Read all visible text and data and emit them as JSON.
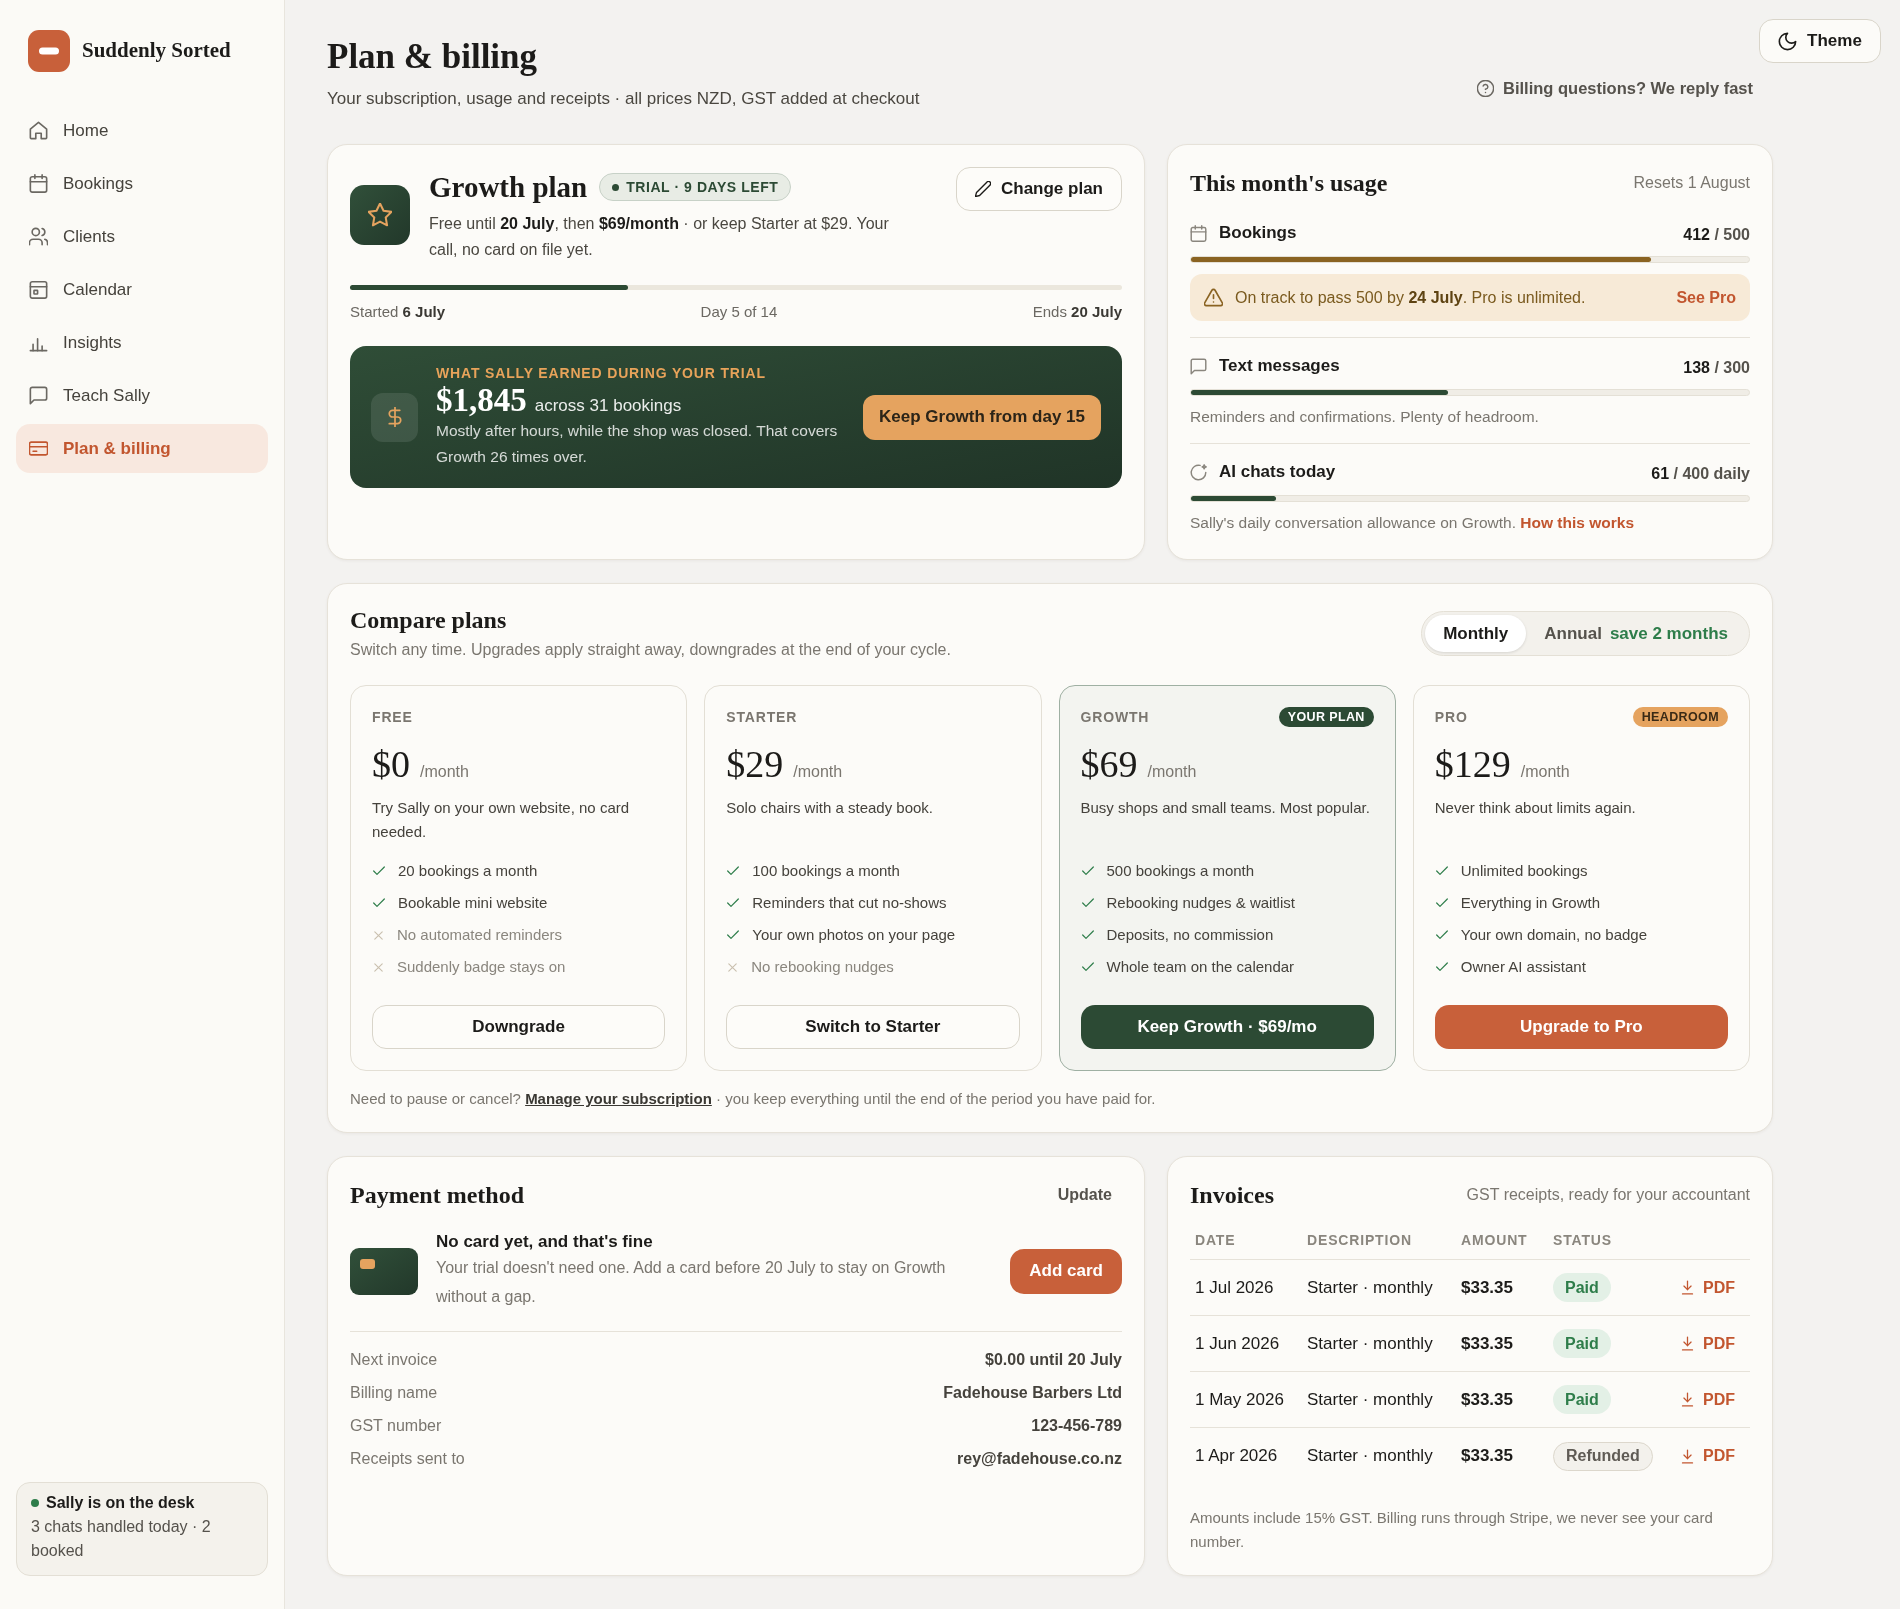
{
  "sidebar": {
    "brand": "Suddenly Sorted",
    "nav": [
      {
        "label": "Home",
        "selected": false
      },
      {
        "label": "Bookings",
        "selected": false
      },
      {
        "label": "Clients",
        "selected": false
      },
      {
        "label": "Calendar",
        "selected": false
      },
      {
        "label": "Insights",
        "selected": false
      },
      {
        "label": "Teach Sally",
        "selected": false
      },
      {
        "label": "Plan & billing",
        "selected": true
      }
    ],
    "status_card": {
      "title": "Sally is on the desk",
      "text": "3 chats handled today · 2 booked",
      "online": true
    }
  },
  "header": {
    "title": "Plan & billing",
    "subtitle": "Your subscription, usage and receipts · all prices NZD, GST added at checkout",
    "help_link": "Billing questions? We reply fast",
    "theme_button": "Theme"
  },
  "current_plan": {
    "name": "Growth plan",
    "badge": "TRIAL · 9 DAYS LEFT",
    "description": "Free until **20 July**, then **$69/month** · or keep Starter at $29. Your call, no card on file yet.",
    "change_button": "Change plan",
    "trial": {
      "level": 0.36,
      "start": "Started **6 July**",
      "progress": "Day 5 of 14",
      "end": "Ends **20 July**"
    },
    "earnings": {
      "eyebrow": "WHAT SALLY EARNED DURING YOUR TRIAL",
      "amount": "$1,845",
      "amount_note": "across 31 bookings",
      "text": "Mostly after hours, while the shop was closed. That covers Growth 26 times over.",
      "button": "Keep Growth from day 15"
    }
  },
  "usage": {
    "title": "This month's usage",
    "resets": "Resets 1 August",
    "meters": [
      {
        "label": "Bookings",
        "reading": "**412** / 500",
        "level": 0.824,
        "near_limit": true,
        "alert": {
          "text": "On track to pass 500 by **24 July**. Pro is unlimited.",
          "link": "See Pro"
        }
      },
      {
        "label": "Text messages",
        "reading": "**138** / 300",
        "level": 0.46,
        "near_limit": false,
        "note": "Reminders and confirmations. Plenty of headroom."
      },
      {
        "label": "AI chats today",
        "reading": "**61** / 400 daily",
        "level": 0.1525,
        "near_limit": false,
        "note": "Sally's daily conversation allowance on Growth.",
        "note_link": "How this works"
      }
    ]
  },
  "compare": {
    "title": "Compare plans",
    "subtitle": "Switch any time. Upgrades apply straight away, downgrades at the end of your cycle.",
    "billing_toggle": [
      {
        "label": "Monthly",
        "selected": true
      },
      {
        "label": "Annual",
        "note": "save 2 months",
        "selected": false
      }
    ],
    "plans": [
      {
        "name": "FREE",
        "price": "$0",
        "period": "/month",
        "description": "Try Sally on your own website, no card needed.",
        "features": [
          {
            "text": "20 bookings a month",
            "included": true
          },
          {
            "text": "Bookable mini website",
            "included": true
          },
          {
            "text": "No automated reminders",
            "included": false
          },
          {
            "text": "Suddenly badge stays on",
            "included": false
          }
        ],
        "button": {
          "label": "Downgrade",
          "kind": "outline"
        },
        "current": false
      },
      {
        "name": "STARTER",
        "price": "$29",
        "period": "/month",
        "description": "Solo chairs with a steady book.",
        "features": [
          {
            "text": "100 bookings a month",
            "included": true
          },
          {
            "text": "Reminders that cut no-shows",
            "included": true
          },
          {
            "text": "Your own photos on your page",
            "included": true
          },
          {
            "text": "No rebooking nudges",
            "included": false
          }
        ],
        "button": {
          "label": "Switch to Starter",
          "kind": "outline"
        },
        "current": false
      },
      {
        "name": "GROWTH",
        "badge": {
          "text": "YOUR PLAN",
          "kind": "dark"
        },
        "price": "$69",
        "period": "/month",
        "description": "Busy shops and small teams. Most popular.",
        "features": [
          {
            "text": "500 bookings a month",
            "included": true
          },
          {
            "text": "Rebooking nudges & waitlist",
            "included": true
          },
          {
            "text": "Deposits, no commission",
            "included": true
          },
          {
            "text": "Whole team on the calendar",
            "included": true
          }
        ],
        "button": {
          "label": "Keep Growth · $69/mo",
          "kind": "dark"
        },
        "current": true
      },
      {
        "name": "PRO",
        "badge": {
          "text": "HEADROOM",
          "kind": "accent"
        },
        "price": "$129",
        "period": "/month",
        "description": "Never think about limits again.",
        "features": [
          {
            "text": "Unlimited bookings",
            "included": true
          },
          {
            "text": "Everything in Growth",
            "included": true
          },
          {
            "text": "Your own domain, no badge",
            "included": true
          },
          {
            "text": "Owner AI assistant",
            "included": true
          }
        ],
        "button": {
          "label": "Upgrade to Pro",
          "kind": "accent"
        },
        "current": false
      }
    ],
    "footer": {
      "before": "Need to pause or cancel?",
      "link": "Manage your subscription",
      "after": "· you keep everything until the end of the period you have paid for."
    }
  },
  "payment": {
    "title": "Payment method",
    "update_link": "Update",
    "notice": {
      "title": "No card yet, and that's fine",
      "text": "Your trial doesn't need one. Add a card before 20 July to stay on Growth without a gap.",
      "button": "Add card"
    },
    "details": [
      {
        "label": "Next invoice",
        "value": "$0.00 until 20 July"
      },
      {
        "label": "Billing name",
        "value": "Fadehouse Barbers Ltd"
      },
      {
        "label": "GST number",
        "value": "123-456-789"
      },
      {
        "label": "Receipts sent to",
        "value": "rey@fadehouse.co.nz"
      }
    ]
  },
  "invoices": {
    "title": "Invoices",
    "subtitle": "GST receipts, ready for your accountant",
    "columns": [
      "DATE",
      "DESCRIPTION",
      "AMOUNT",
      "STATUS"
    ],
    "rows": [
      {
        "date": "1 Jul 2026",
        "description": "Starter · monthly",
        "amount": "$33.35",
        "status": {
          "label": "Paid",
          "kind": "paid"
        },
        "download": "PDF"
      },
      {
        "date": "1 Jun 2026",
        "description": "Starter · monthly",
        "amount": "$33.35",
        "status": {
          "label": "Paid",
          "kind": "paid"
        },
        "download": "PDF"
      },
      {
        "date": "1 May 2026",
        "description": "Starter · monthly",
        "amount": "$33.35",
        "status": {
          "label": "Paid",
          "kind": "paid"
        },
        "download": "PDF"
      },
      {
        "date": "1 Apr 2026",
        "description": "Starter · monthly",
        "amount": "$33.35",
        "status": {
          "label": "Refunded",
          "kind": "refunded"
        },
        "download": "PDF"
      }
    ],
    "footnote": "Amounts include 15% GST. Billing runs through Stripe, we never see your card number."
  }
}
